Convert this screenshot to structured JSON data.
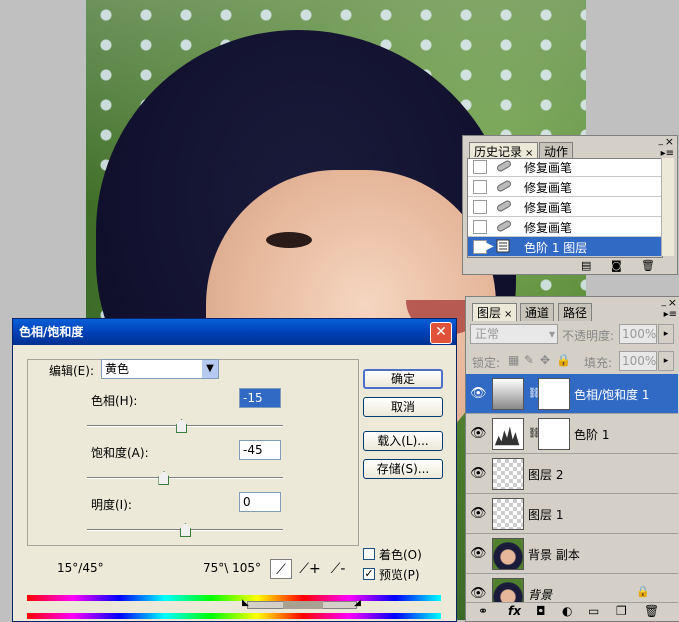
{
  "history_panel": {
    "tabs": [
      "历史记录",
      "动作"
    ],
    "close_glyph": "×",
    "rows": [
      {
        "label": "修复画笔",
        "icon": "healing-brush-icon"
      },
      {
        "label": "修复画笔",
        "icon": "healing-brush-icon"
      },
      {
        "label": "修复画笔",
        "icon": "healing-brush-icon"
      },
      {
        "label": "修复画笔",
        "icon": "healing-brush-icon"
      },
      {
        "label": "色阶 1 图层",
        "icon": "levels-layer-icon",
        "selected": true
      }
    ]
  },
  "layers_panel": {
    "tabs": [
      "图层",
      "通道",
      "路径"
    ],
    "close_glyph": "×",
    "blend_mode": "正常",
    "opacity_label": "不透明度:",
    "opacity_value": "100%",
    "lock_label": "锁定:",
    "fill_label": "填充:",
    "fill_value": "100%",
    "layers": [
      {
        "name": "色相/饱和度 1",
        "selected": true
      },
      {
        "name": "色阶 1"
      },
      {
        "name": "图层 2"
      },
      {
        "name": "图层 1"
      },
      {
        "name": "背景 副本"
      },
      {
        "name": "背景"
      }
    ],
    "footer_icons": [
      "link-icon",
      "fx-icon",
      "mask-icon",
      "adjustment-icon",
      "folder-icon",
      "new-layer-icon",
      "trash-icon"
    ]
  },
  "dialog": {
    "title": "色相/饱和度",
    "edit_label": "编辑(E):",
    "edit_value": "黄色",
    "hue_label": "色相(H):",
    "hue_value": "-15",
    "saturation_label": "饱和度(A):",
    "saturation_value": "-45",
    "lightness_label": "明度(I):",
    "lightness_value": "0",
    "hue_slider": 0.48,
    "saturation_slider": 0.39,
    "lightness_slider": 0.5,
    "range_left": "15°/45°",
    "range_right": "75°\\ 105°",
    "buttons": {
      "ok": "确定",
      "cancel": "取消",
      "load": "载入(L)...",
      "save": "存储(S)..."
    },
    "colorize_label": "着色(O)",
    "colorize_checked": false,
    "preview_label": "预览(P)",
    "preview_checked": true,
    "close_glyph": "✕"
  }
}
